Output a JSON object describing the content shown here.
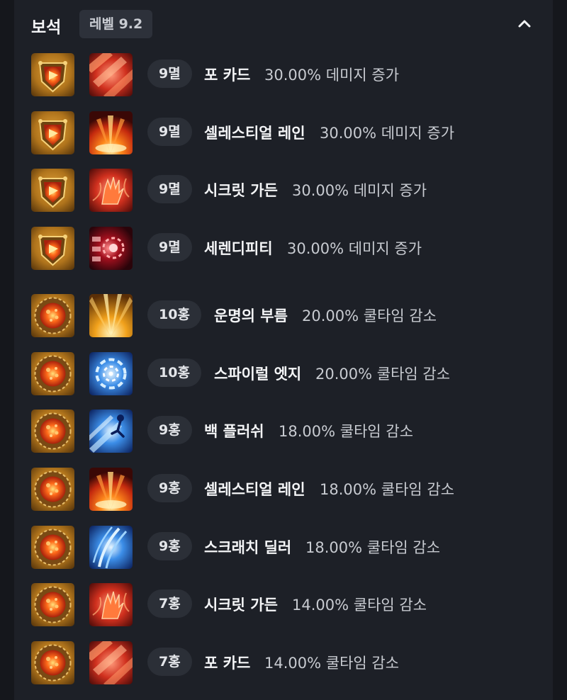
{
  "header": {
    "title": "보석",
    "level": "레벨 9.2",
    "collapse_icon": "chevron-up-icon"
  },
  "colors": {
    "panel_bg": "#1d2027",
    "badge_bg": "#2b2f37",
    "text_primary": "#f4f5f7",
    "text_secondary": "#c8cbd1"
  },
  "gems": [
    {
      "gem_type": "annihilation-gem",
      "skill_icon": "fire-red-slash",
      "grade": "9멸",
      "skill": "포 카드",
      "effect": "30.00% 데미지 증가"
    },
    {
      "gem_type": "annihilation-gem",
      "skill_icon": "fire-burst",
      "grade": "9멸",
      "skill": "셀레스티얼 레인",
      "effect": "30.00% 데미지 증가"
    },
    {
      "gem_type": "annihilation-gem",
      "skill_icon": "fire-hand",
      "grade": "9멸",
      "skill": "시크릿 가든",
      "effect": "30.00% 데미지 증가"
    },
    {
      "gem_type": "annihilation-gem",
      "skill_icon": "crimson-vortex",
      "grade": "9멸",
      "skill": "세렌디피티",
      "effect": "30.00% 데미지 증가"
    },
    {
      "gem_type": "crimson-flame-gem",
      "skill_icon": "golden-rays",
      "grade": "10홍",
      "skill": "운명의 부름",
      "effect": "20.00% 쿨타임 감소"
    },
    {
      "gem_type": "crimson-flame-gem",
      "skill_icon": "blue-spiral",
      "grade": "10홍",
      "skill": "스파이럴 엣지",
      "effect": "20.00% 쿨타임 감소"
    },
    {
      "gem_type": "crimson-flame-gem",
      "skill_icon": "blue-dash",
      "grade": "9홍",
      "skill": "백 플러쉬",
      "effect": "18.00% 쿨타임 감소"
    },
    {
      "gem_type": "crimson-flame-gem",
      "skill_icon": "fire-burst",
      "grade": "9홍",
      "skill": "셀레스티얼 레인",
      "effect": "18.00% 쿨타임 감소"
    },
    {
      "gem_type": "crimson-flame-gem",
      "skill_icon": "blue-slash",
      "grade": "9홍",
      "skill": "스크래치 딜러",
      "effect": "18.00% 쿨타임 감소"
    },
    {
      "gem_type": "crimson-flame-gem",
      "skill_icon": "fire-hand",
      "grade": "7홍",
      "skill": "시크릿 가든",
      "effect": "14.00% 쿨타임 감소"
    },
    {
      "gem_type": "crimson-flame-gem",
      "skill_icon": "fire-red-slash",
      "grade": "7홍",
      "skill": "포 카드",
      "effect": "14.00% 쿨타임 감소"
    }
  ]
}
